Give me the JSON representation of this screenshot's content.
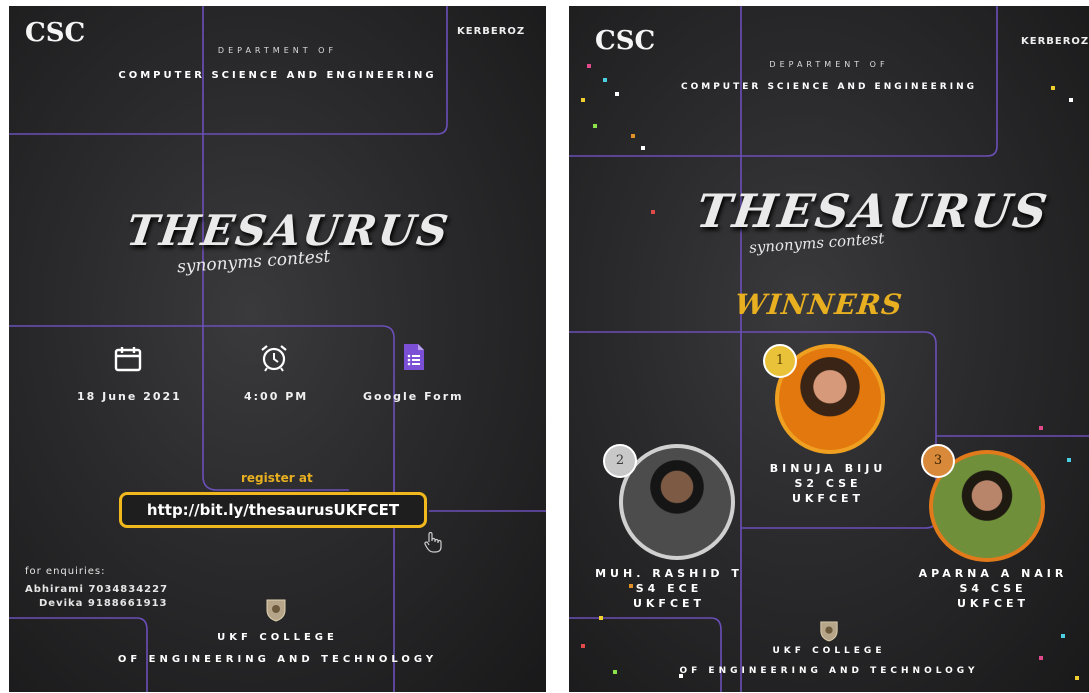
{
  "left_poster": {
    "logo_text": "CSC",
    "sponsor": "KERBEROZ",
    "dept_line1": "DEPARTMENT OF",
    "dept_line2": "COMPUTER SCIENCE AND ENGINEERING",
    "title": "THESAURUS",
    "subtitle": "synonyms contest",
    "date": "18 June 2021",
    "time": "4:00 PM",
    "form": "Google Form",
    "register_label": "register at",
    "register_link": "http://bit.ly/thesaurusUKFCET",
    "enquiries_label": "for enquiries:",
    "contacts": [
      "Abhirami 7034834227",
      "Devika 9188661913"
    ],
    "college_line1": "UKF COLLEGE",
    "college_line2": "OF ENGINEERING AND TECHNOLOGY"
  },
  "right_poster": {
    "logo_text": "CSC",
    "sponsor": "KERBEROZ",
    "dept_line1": "DEPARTMENT OF",
    "dept_line2": "COMPUTER SCIENCE AND ENGINEERING",
    "title": "THESAURUS",
    "subtitle": "synonyms contest",
    "winners_heading": "WINNERS",
    "winners": [
      {
        "place": "1",
        "name": "BINUJA BIJU",
        "class": "S2 CSE",
        "college": "UKFCET"
      },
      {
        "place": "2",
        "name": "MUH. RASHID T",
        "class": "S4 ECE",
        "college": "UKFCET"
      },
      {
        "place": "3",
        "name": "APARNA A NAIR",
        "class": "S4 CSE",
        "college": "UKFCET"
      }
    ],
    "college_line1": "UKF COLLEGE",
    "college_line2": "OF ENGINEERING AND TECHNOLOGY"
  },
  "colors": {
    "grid_line": "#6b4fb8",
    "link_border": "#f0b81c",
    "gold_text": "#e8b020",
    "gold_medal": "#e9c23a",
    "silver_medal": "#c8c8c8",
    "bronze_medal": "#d88a3a",
    "photo_ring_gold": "#f0a020",
    "photo_ring_silver": "#d0d0d0",
    "photo_ring_bronze": "#e07a1a"
  },
  "icons": [
    "calendar-icon",
    "alarm-clock-icon",
    "google-form-icon",
    "hand-cursor-icon",
    "college-emblem-icon"
  ]
}
